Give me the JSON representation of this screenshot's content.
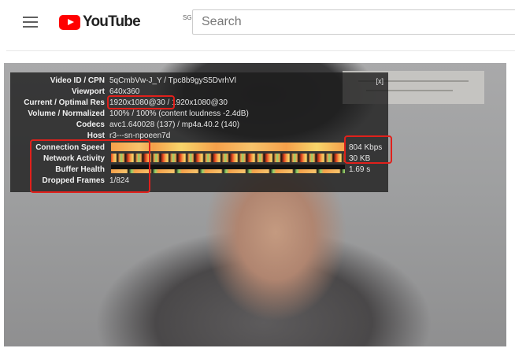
{
  "header": {
    "logo_text": "YouTube",
    "logo_region": "SG",
    "search_placeholder": "Search"
  },
  "stats_panel": {
    "close_label": "[x]",
    "rows": [
      {
        "label": "Video ID / CPN",
        "value": "5qCmbVw-J_Y / Tpc8b9gyS5DvrhVl"
      },
      {
        "label": "Viewport",
        "value": "640x360"
      },
      {
        "label": "Current / Optimal Res",
        "value_current": "1920x1080@30",
        "value_rest": " / 1920x1080@30"
      },
      {
        "label": "Volume / Normalized",
        "value": "100% / 100% (content loudness -2.4dB)"
      },
      {
        "label": "Codecs",
        "value": "avc1.640028 (137) / mp4a.40.2 (140)"
      },
      {
        "label": "Host",
        "value": "r3---sn-npoeen7d"
      },
      {
        "label": "Connection Speed",
        "value": "804 Kbps"
      },
      {
        "label": "Network Activity",
        "value": "30 KB"
      },
      {
        "label": "Buffer Health",
        "value": "1.69 s"
      },
      {
        "label": "Dropped Frames",
        "value": "1/824"
      }
    ]
  },
  "colors": {
    "accent_red": "#ff0000",
    "highlight_red": "#e0201b",
    "graph_orange": "#f5a04a",
    "graph_yellow": "#f7d56b",
    "graph_red": "#e5451f",
    "graph_green": "#8fd36b"
  },
  "icons": [
    "menu-icon",
    "youtube-logo-icon"
  ]
}
